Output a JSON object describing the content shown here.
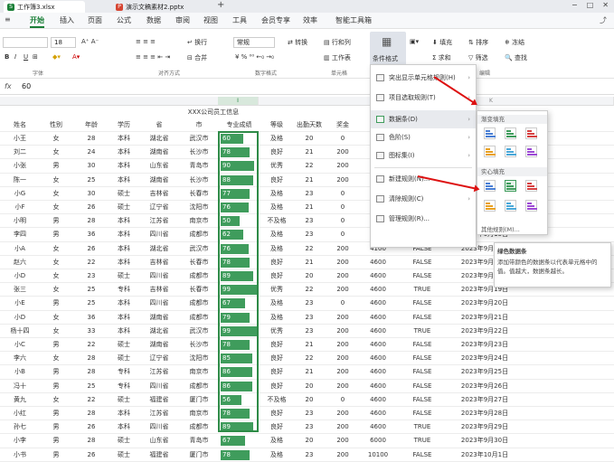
{
  "tabs": [
    {
      "label": "工作簿3.xlsx"
    },
    {
      "label": "演示文稿素材2.pptx"
    }
  ],
  "menu": [
    "开始",
    "插入",
    "页面",
    "公式",
    "数据",
    "审阅",
    "视图",
    "工具",
    "会员专享",
    "效率",
    "智能工具箱"
  ],
  "ribbon": {
    "font_size": "18",
    "number_format": "常规",
    "wrap": "换行",
    "merge": "合并",
    "row_col": "行和列",
    "worksheet": "工作表",
    "cond_format": "条件格式",
    "fill": "填充",
    "sort": "排序",
    "freeze": "冻结",
    "sum": "求和",
    "filter": "筛选",
    "find": "查找",
    "groups": [
      "字体",
      "对齐方式",
      "数字格式",
      "单元格",
      "编辑"
    ]
  },
  "formula": {
    "fx": "fx",
    "value": "60"
  },
  "columns": [
    "",
    "",
    "",
    "",
    "",
    "",
    "",
    "",
    "I",
    "",
    "",
    "",
    "",
    "",
    "",
    "",
    "",
    "",
    "",
    "",
    "",
    "K"
  ],
  "sheet_title": "XXX公司员工信息",
  "headers": [
    "姓名",
    "性别",
    "年龄",
    "学历",
    "省",
    "市",
    "专业成绩",
    "等级",
    "出勤天数",
    "奖金"
  ],
  "rows": [
    [
      "小王",
      "女",
      "28",
      "本科",
      "湖北省",
      "武汉市",
      "60",
      "及格",
      "20",
      "0",
      "",
      "",
      ""
    ],
    [
      "刘二",
      "女",
      "24",
      "本科",
      "湖南省",
      "长沙市",
      "78",
      "良好",
      "21",
      "200",
      "",
      "",
      ""
    ],
    [
      "小张",
      "男",
      "30",
      "本科",
      "山东省",
      "青岛市",
      "90",
      "优秀",
      "22",
      "200",
      "",
      "",
      ""
    ],
    [
      "陈一",
      "女",
      "25",
      "本科",
      "湖南省",
      "长沙市",
      "88",
      "良好",
      "21",
      "200",
      "",
      "",
      ""
    ],
    [
      "小G",
      "女",
      "30",
      "硕士",
      "吉林省",
      "长春市",
      "77",
      "及格",
      "23",
      "0",
      "",
      "",
      ""
    ],
    [
      "小F",
      "女",
      "26",
      "硕士",
      "辽宁省",
      "沈阳市",
      "76",
      "及格",
      "21",
      "0",
      "",
      "",
      ""
    ],
    [
      "小明",
      "男",
      "28",
      "本科",
      "江苏省",
      "南京市",
      "50",
      "不及格",
      "23",
      "0",
      "",
      "",
      ""
    ],
    [
      "李四",
      "男",
      "36",
      "本科",
      "四川省",
      "成都市",
      "62",
      "及格",
      "23",
      "0",
      "",
      "FALSE",
      "2023年9月15日"
    ],
    [
      "小A",
      "女",
      "26",
      "本科",
      "湖北省",
      "武汉市",
      "76",
      "及格",
      "22",
      "200",
      "4100",
      "FALSE",
      "2023年9月16日"
    ],
    [
      "赵六",
      "女",
      "22",
      "本科",
      "吉林省",
      "长春市",
      "78",
      "良好",
      "21",
      "200",
      "4600",
      "FALSE",
      "2023年9月17日"
    ],
    [
      "小D",
      "女",
      "23",
      "硕士",
      "四川省",
      "成都市",
      "89",
      "良好",
      "20",
      "200",
      "4600",
      "FALSE",
      "2023年9月18日"
    ],
    [
      "张三",
      "女",
      "25",
      "专科",
      "吉林省",
      "长春市",
      "99",
      "优秀",
      "22",
      "200",
      "4600",
      "TRUE",
      "2023年9月19日"
    ],
    [
      "小E",
      "男",
      "25",
      "本科",
      "四川省",
      "成都市",
      "67",
      "及格",
      "23",
      "0",
      "4600",
      "FALSE",
      "2023年9月20日"
    ],
    [
      "小D",
      "女",
      "36",
      "本科",
      "湖南省",
      "成都市",
      "79",
      "及格",
      "23",
      "200",
      "4600",
      "FALSE",
      "2023年9月21日"
    ],
    [
      "杨十四",
      "女",
      "33",
      "本科",
      "湖北省",
      "武汉市",
      "99",
      "优秀",
      "23",
      "200",
      "4600",
      "TRUE",
      "2023年9月22日"
    ],
    [
      "小C",
      "男",
      "22",
      "硕士",
      "湖南省",
      "长沙市",
      "78",
      "良好",
      "21",
      "200",
      "4600",
      "FALSE",
      "2023年9月23日"
    ],
    [
      "李六",
      "女",
      "28",
      "硕士",
      "辽宁省",
      "沈阳市",
      "85",
      "良好",
      "22",
      "200",
      "4600",
      "FALSE",
      "2023年9月24日"
    ],
    [
      "小B",
      "男",
      "28",
      "专科",
      "江苏省",
      "南京市",
      "86",
      "良好",
      "21",
      "200",
      "4600",
      "FALSE",
      "2023年9月25日"
    ],
    [
      "冯十",
      "男",
      "25",
      "专科",
      "四川省",
      "成都市",
      "86",
      "良好",
      "20",
      "200",
      "4600",
      "FALSE",
      "2023年9月26日"
    ],
    [
      "黄九",
      "女",
      "22",
      "硕士",
      "福建省",
      "厦门市",
      "56",
      "不及格",
      "20",
      "0",
      "4600",
      "FALSE",
      "2023年9月27日"
    ],
    [
      "小红",
      "男",
      "28",
      "本科",
      "江苏省",
      "南京市",
      "78",
      "良好",
      "23",
      "200",
      "4600",
      "FALSE",
      "2023年9月28日"
    ],
    [
      "孙七",
      "男",
      "26",
      "本科",
      "四川省",
      "成都市",
      "89",
      "良好",
      "23",
      "200",
      "4600",
      "TRUE",
      "2023年9月29日"
    ],
    [
      "小李",
      "男",
      "28",
      "硕士",
      "山东省",
      "青岛市",
      "67",
      "及格",
      "20",
      "200",
      "6000",
      "TRUE",
      "2023年9月30日"
    ],
    [
      "小书",
      "男",
      "26",
      "硕士",
      "福建省",
      "厦门市",
      "78",
      "及格",
      "23",
      "200",
      "10100",
      "FALSE",
      "2023年10月1日"
    ]
  ],
  "dropdown": [
    {
      "label": "突出显示单元格规则(H)",
      "arrow": "›"
    },
    {
      "label": "项目选取规则(T)",
      "arrow": "›"
    },
    {
      "label": "数据条(D)",
      "arrow": "›"
    },
    {
      "label": "色阶(S)",
      "arrow": "›"
    },
    {
      "label": "图标集(I)",
      "arrow": "›"
    },
    {
      "label": "新建规则(N)...",
      "arrow": ""
    },
    {
      "label": "清除规则(C)",
      "arrow": "›"
    },
    {
      "label": "管理规则(R)...",
      "arrow": ""
    }
  ],
  "submenu": {
    "gradient_label": "渐变填充",
    "solid_label": "实心填充",
    "other": "其他规则(M)..."
  },
  "tooltip": {
    "title": "绿色数据条",
    "desc": "添加带颜色的数据条以代表单元格中的值。值越大，数据条越长。"
  },
  "colors": {
    "accent": "#1a7f37",
    "bar": "#3f9c5c",
    "arrow": "#dd1111"
  }
}
